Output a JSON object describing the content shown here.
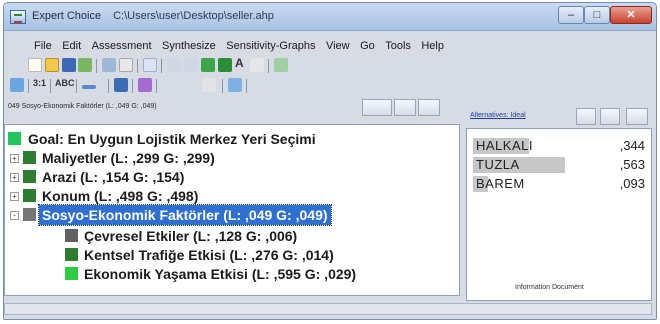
{
  "window": {
    "app_name": "Expert Choice",
    "file_path": "C:\\Users\\user\\Desktop\\seller.ahp",
    "minimize": "–",
    "maximize": "□",
    "close": "✕"
  },
  "menu": [
    "File",
    "Edit",
    "Assessment",
    "Synthesize",
    "Sensitivity-Graphs",
    "View",
    "Go",
    "Tools",
    "Help"
  ],
  "toolbar2": {
    "ratio_label": "3:1",
    "abc_label": "ABC",
    "font_label": "A"
  },
  "tree_header": {
    "node_path": "049 Sosyo-Ekonomik Faktörler (L: ,049 G: ,049)"
  },
  "tree": {
    "goal": "Goal: En Uygun Lojistik Merkez Yeri Seçimi",
    "criteria": [
      {
        "label": "Maliyetler (L: ,299 G: ,299)",
        "color": "#2e7d32",
        "expander": "+"
      },
      {
        "label": "Arazi (L: ,154 G: ,154)",
        "color": "#2e7d32",
        "expander": "+"
      },
      {
        "label": "Konum (L: ,498 G: ,498)",
        "color": "#2e7d32",
        "expander": "+"
      },
      {
        "label": "Sosyo-Ekonomik Faktörler (L: ,049 G: ,049)",
        "color": "#757575",
        "expander": "-",
        "selected": true
      }
    ],
    "subcriteria": [
      {
        "label": "Çevresel Etkiler (L: ,128 G: ,006)",
        "color": "#616161"
      },
      {
        "label": "Kentsel Trafiğe Etkisi (L: ,276 G: ,014)",
        "color": "#2e7d32"
      },
      {
        "label": "Ekonomik Yaşama Etkisi (L: ,595 G: ,029)",
        "color": "#2ecc40"
      }
    ]
  },
  "alternatives_header": {
    "link": "Alternatives: Ideal"
  },
  "alternatives": [
    {
      "name": "HALKALI",
      "value": ",344",
      "share": 0.344
    },
    {
      "name": "TUZLA",
      "value": ",563",
      "share": 0.563
    },
    {
      "name": "BAREM",
      "value": ",093",
      "share": 0.093
    }
  ],
  "info_document": "Information Document",
  "colors": {
    "goal_square": "#22c55e",
    "selection": "#2f6fd1",
    "alt_bar": "#c7c7c7"
  }
}
